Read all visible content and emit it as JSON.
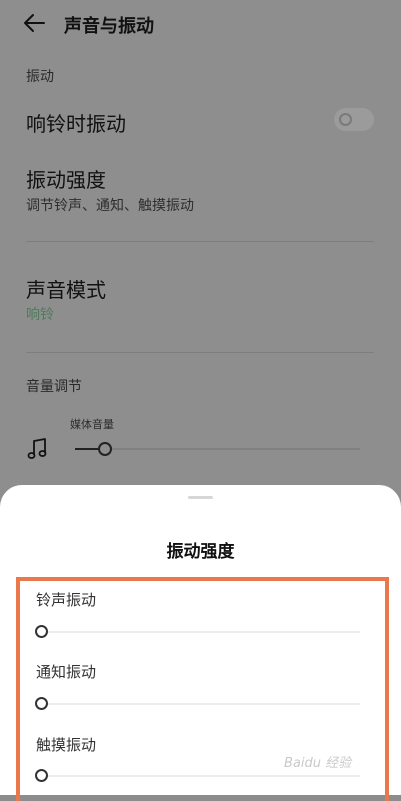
{
  "header": {
    "title": "声音与振动"
  },
  "vibration_section": {
    "label": "振动"
  },
  "ring_vibrate": {
    "label": "响铃时振动",
    "toggle_on": false
  },
  "vibration_strength": {
    "label": "振动强度",
    "sub": "调节铃声、通知、触摸振动"
  },
  "sound_mode": {
    "label": "声音模式",
    "value": "响铃",
    "value_color": "#4f7a5c"
  },
  "volume_section": {
    "label": "音量调节"
  },
  "media_volume": {
    "label": "媒体音量",
    "icon": "music-note-icon",
    "level": 0.1
  },
  "sheet": {
    "title": "振动强度",
    "items": [
      {
        "label": "铃声振动",
        "level": 0
      },
      {
        "label": "通知振动",
        "level": 0
      },
      {
        "label": "触摸振动",
        "level": 0
      }
    ]
  },
  "highlight_color": "#e9784b",
  "watermark": "Baidu 经验"
}
